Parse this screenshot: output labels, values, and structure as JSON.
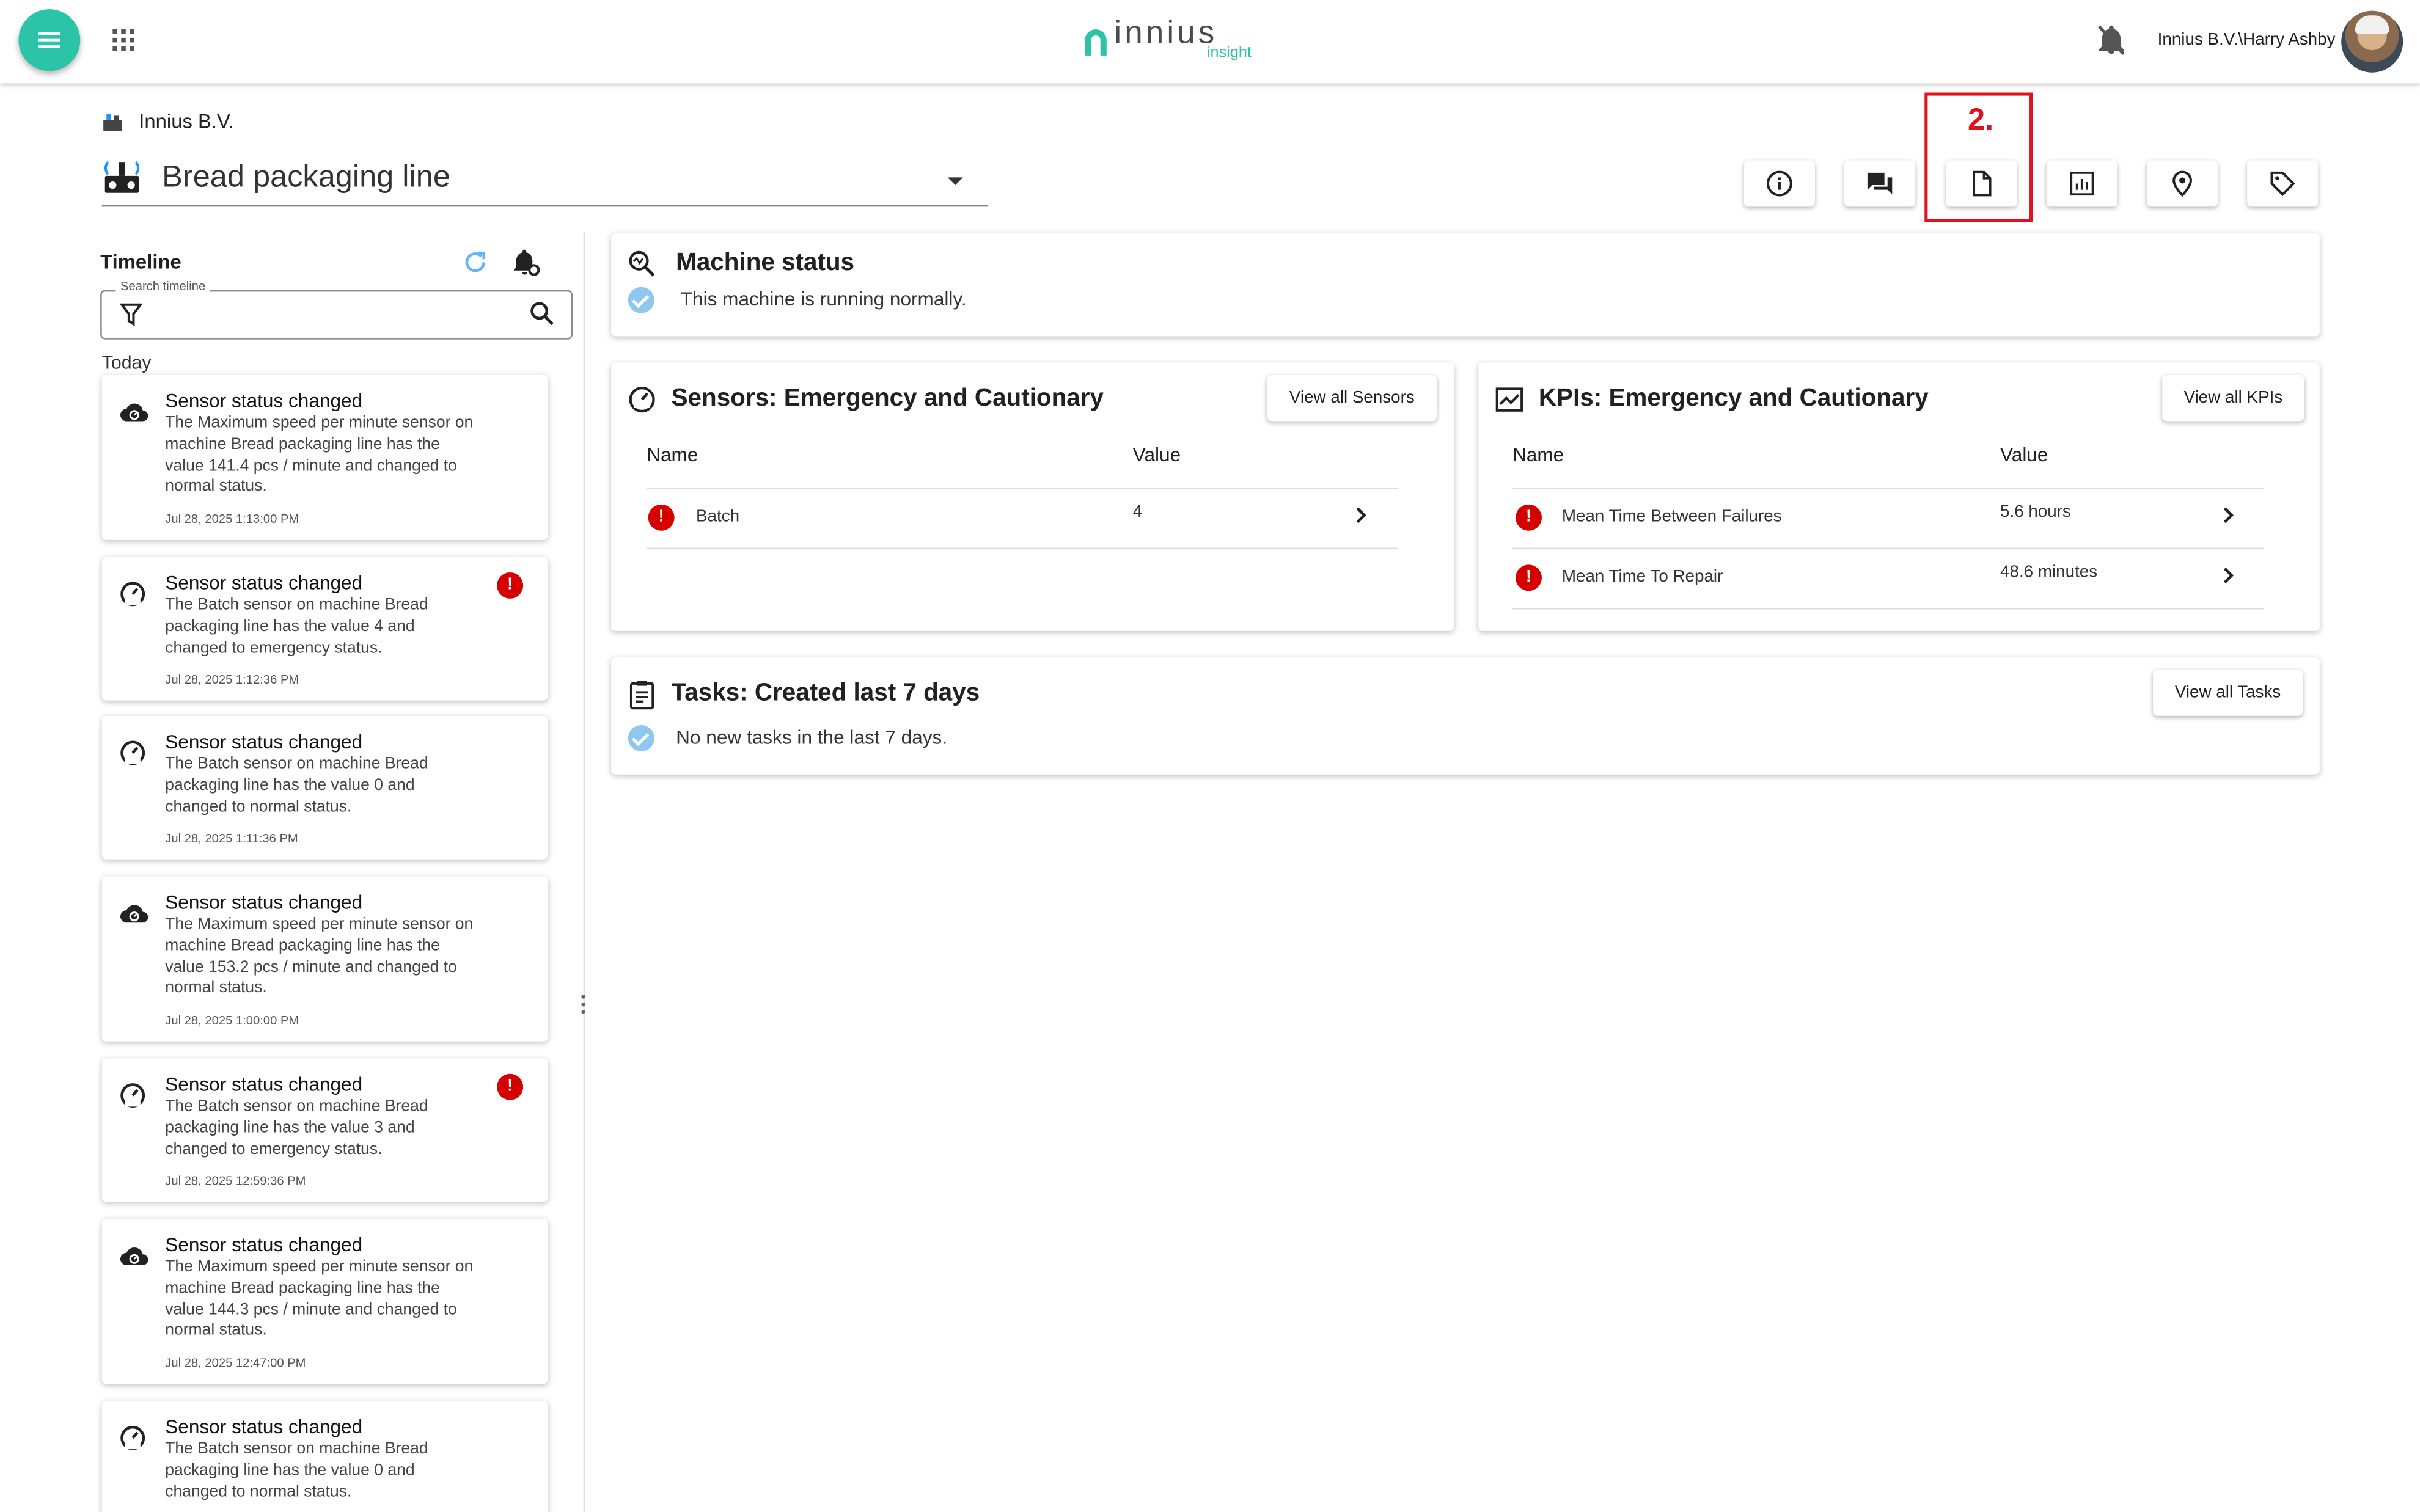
{
  "app": {
    "logo_text": "innius",
    "logo_sub": "insight",
    "user_name": "Innius B.V.\\Harry Ashby"
  },
  "header": {
    "org_name": "Innius B.V.",
    "machine_name": "Bread packaging line",
    "toolbar_icons": [
      "info-icon",
      "chat-icon",
      "document-icon",
      "report-icon",
      "location-icon",
      "tag-icon"
    ],
    "highlight_label": "2."
  },
  "timeline": {
    "title": "Timeline",
    "search_label": "Search timeline",
    "day_label": "Today",
    "items": [
      {
        "icon": "cloud-sensor-icon",
        "title": "Sensor status changed",
        "body": "The Maximum speed per minute sensor on machine Bread packaging line has the value 141.4 pcs / minute and changed to normal status.",
        "time": "Jul 28, 2025 1:13:00 PM",
        "alert": false
      },
      {
        "icon": "gauge-icon",
        "title": "Sensor status changed",
        "body": "The Batch sensor on machine Bread packaging line has the value 4 and changed to emergency status.",
        "time": "Jul 28, 2025 1:12:36 PM",
        "alert": true
      },
      {
        "icon": "gauge-icon",
        "title": "Sensor status changed",
        "body": "The Batch sensor on machine Bread packaging line has the value 0 and changed to normal status.",
        "time": "Jul 28, 2025 1:11:36 PM",
        "alert": false
      },
      {
        "icon": "cloud-sensor-icon",
        "title": "Sensor status changed",
        "body": "The Maximum speed per minute sensor on machine Bread packaging line has the value 153.2 pcs / minute and changed to normal status.",
        "time": "Jul 28, 2025 1:00:00 PM",
        "alert": false
      },
      {
        "icon": "gauge-icon",
        "title": "Sensor status changed",
        "body": "The Batch sensor on machine Bread packaging line has the value 3 and changed to emergency status.",
        "time": "Jul 28, 2025 12:59:36 PM",
        "alert": true
      },
      {
        "icon": "cloud-sensor-icon",
        "title": "Sensor status changed",
        "body": "The Maximum speed per minute sensor on machine Bread packaging line has the value 144.3 pcs / minute and changed to normal status.",
        "time": "Jul 28, 2025 12:47:00 PM",
        "alert": false
      },
      {
        "icon": "gauge-icon",
        "title": "Sensor status changed",
        "body": "The Batch sensor on machine Bread packaging line has the value 0 and changed to normal status.",
        "time": "",
        "alert": false
      }
    ]
  },
  "machine_status": {
    "title": "Machine status",
    "message": "This machine is running normally."
  },
  "sensors": {
    "title": "Sensors: Emergency and Cautionary",
    "view_all": "View all Sensors",
    "col_name": "Name",
    "col_value": "Value",
    "rows": [
      {
        "name": "Batch",
        "value": "4"
      }
    ]
  },
  "kpis": {
    "title": "KPIs: Emergency and Cautionary",
    "view_all": "View all KPIs",
    "col_name": "Name",
    "col_value": "Value",
    "rows": [
      {
        "name": "Mean Time Between Failures",
        "value": "5.6 hours"
      },
      {
        "name": "Mean Time To Repair",
        "value": "48.6 minutes"
      }
    ]
  },
  "tasks": {
    "title": "Tasks: Created last 7 days",
    "view_all": "View all Tasks",
    "message": "No new tasks in the last 7 days."
  },
  "colors": {
    "accent": "#2bc4a8",
    "alert": "#d50000",
    "highlight": "#e0121c",
    "check": "#8ec8f0"
  }
}
